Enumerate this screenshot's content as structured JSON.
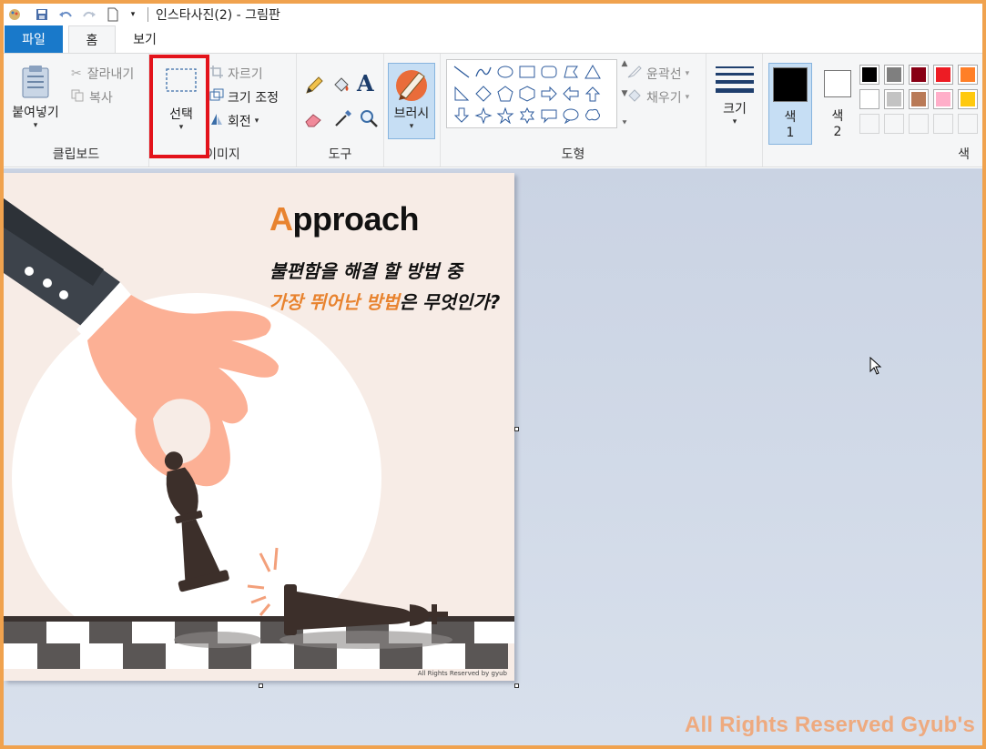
{
  "window": {
    "title": "인스타사진(2) - 그림판"
  },
  "quick_access": {
    "icons": [
      "paint-app-icon",
      "save-icon",
      "undo-icon",
      "redo-icon",
      "new-doc-icon",
      "customize-dropdown-icon"
    ]
  },
  "tabs": {
    "file": "파일",
    "home": "홈",
    "view": "보기"
  },
  "ribbon": {
    "clipboard": {
      "label": "클립보드",
      "paste": "붙여넣기",
      "cut": "잘라내기",
      "copy": "복사"
    },
    "image": {
      "label": "이미지",
      "select": "선택",
      "crop": "자르기",
      "resize": "크기 조정",
      "rotate": "회전"
    },
    "tools": {
      "label": "도구"
    },
    "brushes": {
      "label": "브러시"
    },
    "shapes": {
      "label": "도형",
      "outline": "윤곽선",
      "fill": "채우기"
    },
    "size": {
      "label": "크기"
    },
    "colors": {
      "label": "색",
      "color1_label": "색",
      "color1_num": "1",
      "color2_label": "색",
      "color2_num": "2",
      "color1_value": "#000000",
      "color2_value": "#ffffff",
      "palette": [
        "#000000",
        "#7f7f7f",
        "#880015",
        "#ed1c24",
        "#ff7f27",
        "#ffffff",
        "#c3c3c3",
        "#b97a57",
        "#ffaec9",
        "#ffc90e",
        "",
        "",
        "",
        "",
        ""
      ]
    }
  },
  "canvas": {
    "title_first_letter": "A",
    "title_rest": "pproach",
    "line1": "불편함을 해결 할 방법 중",
    "line2_a": "가장 뛰어난 방법",
    "line2_b": "은 무엇인가?",
    "image_copyright": "All Rights Reserved by gyub"
  },
  "watermark": "All Rights Reserved Gyub's",
  "accent_colors": {
    "highlight": "#e3131b",
    "file_tab": "#1979ca",
    "orange": "#e8832f"
  }
}
